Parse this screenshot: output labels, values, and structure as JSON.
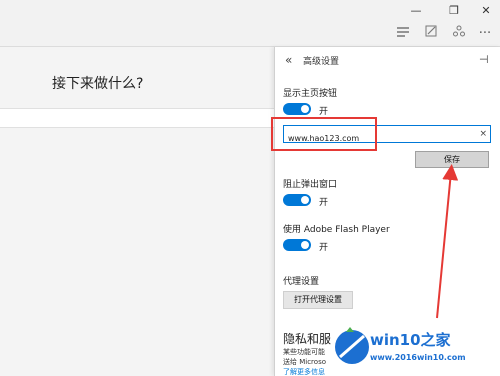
{
  "window": {
    "minimize_icon": "minimize-icon",
    "restore_icon": "restore-icon",
    "close_icon": "close-icon"
  },
  "toolbar": {
    "icons": [
      "hub-icon",
      "web-note-icon",
      "share-icon",
      "more-icon"
    ],
    "more_label": "···"
  },
  "page": {
    "heading": "接下来做什么?"
  },
  "panel": {
    "back_glyph": "«",
    "title": "高级设置",
    "pin_glyph": "⊣",
    "show_home_label": "显示主页按钮",
    "show_home_state": "开",
    "homepage_value": "www.hao123.com",
    "clear_glyph": "×",
    "save_label": "保存",
    "popup_label": "阻止弹出窗口",
    "popup_state": "开",
    "flash_label": "使用 Adobe Flash Player",
    "flash_state": "开",
    "proxy_label": "代理设置",
    "proxy_button": "打开代理设置",
    "privacy_title": "隐私和服",
    "privacy_desc_1": "某些功能可能",
    "privacy_desc_2": "送给 Microso",
    "privacy_link": "了解更多信息"
  },
  "watermark": {
    "brand": "win10之家",
    "url": "www.2016win10.com"
  },
  "colors": {
    "accent": "#0078d7",
    "annotation": "#e53935",
    "watermark": "#1c6fd1"
  }
}
